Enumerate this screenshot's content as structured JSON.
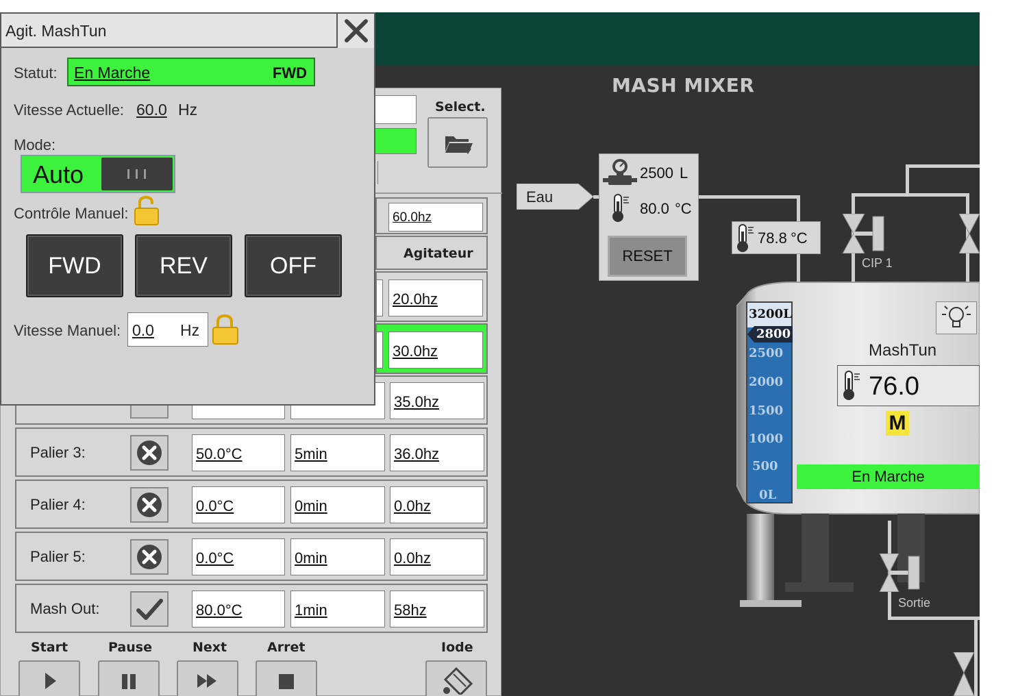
{
  "hmi": {
    "title": "MASH MIXER",
    "eau_label": "Eau",
    "volume_value": "2500",
    "volume_unit": "L",
    "inlet_temp": "80.0",
    "inlet_temp_unit": "°C",
    "reset_label": "RESET",
    "pipe_temp": "78.8",
    "pipe_temp_unit": "°C",
    "cip_label": "CIP 1",
    "sortie_label": "Sortie",
    "tank": {
      "name": "MashTun",
      "temperature": "76.0",
      "mode_badge": "M",
      "status": "En Marche",
      "level_max": "3200L",
      "level_current": "2800",
      "level_fraction": 0.875,
      "scale": [
        "2500",
        "2000",
        "1500",
        "1000",
        "500",
        "0L"
      ]
    }
  },
  "recipe": {
    "select_label": "Select.",
    "top_speed": "60.0hz",
    "agitateur_header": "Agitateur",
    "rows": [
      {
        "label": "",
        "temp": "",
        "time": "",
        "speed": "20.0hz"
      },
      {
        "label": "",
        "temp": "",
        "time": "",
        "speed": "30.0hz"
      },
      {
        "label": "",
        "temp": "",
        "time": "",
        "speed": "35.0hz"
      },
      {
        "label": "Palier 3:",
        "temp": "50.0°C",
        "time": "5min",
        "speed": "36.0hz"
      },
      {
        "label": "Palier 4:",
        "temp": "0.0°C",
        "time": "0min",
        "speed": "0.0hz"
      },
      {
        "label": "Palier 5:",
        "temp": "0.0°C",
        "time": "0min",
        "speed": "0.0hz"
      },
      {
        "label": "Mash Out:",
        "temp": "80.0°C",
        "time": "1min",
        "speed": "58hz"
      }
    ],
    "controls": {
      "start": "Start",
      "pause": "Pause",
      "next": "Next",
      "arret": "Arret",
      "iode": "Iode"
    }
  },
  "popup": {
    "title": "Agit. MashTun",
    "statut_label": "Statut:",
    "statut_value": "En Marche",
    "statut_dir": "FWD",
    "vitesse_actuelle_label": "Vitesse Actuelle:",
    "vitesse_actuelle_value": "60.0",
    "vitesse_actuelle_unit": "Hz",
    "mode_label": "Mode:",
    "mode_value": "Auto",
    "controle_label": "Contrôle Manuel:",
    "btn_fwd": "FWD",
    "btn_rev": "REV",
    "btn_off": "OFF",
    "vitesse_manuel_label": "Vitesse Manuel:",
    "vitesse_manuel_value": "0.0",
    "vitesse_manuel_unit": "Hz"
  },
  "colors": {
    "header_green": "#0b4436",
    "active_green": "#3cf23c",
    "hmi_bg": "#323232",
    "level_blue": "#2b6fb3",
    "badge_yellow": "#f5e53a"
  }
}
